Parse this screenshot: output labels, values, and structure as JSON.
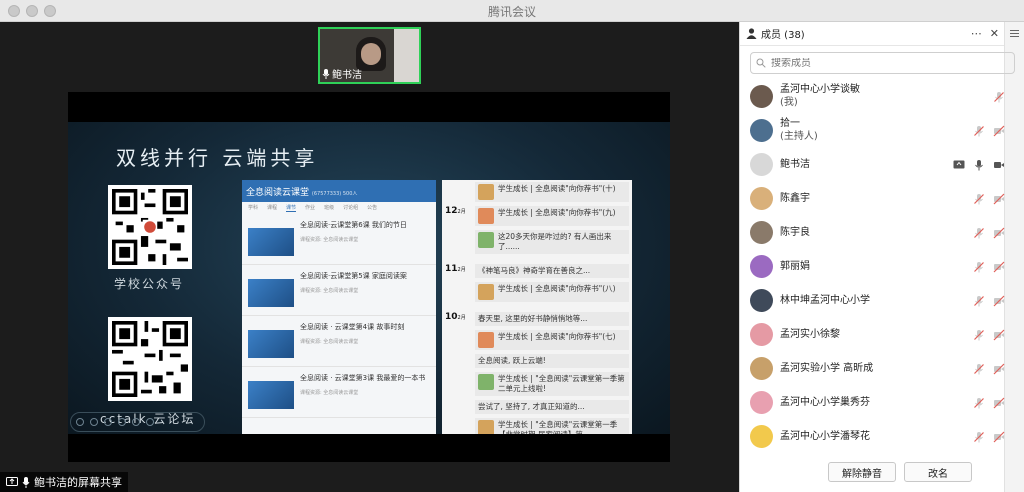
{
  "window": {
    "title": "腾讯会议"
  },
  "video": {
    "self_name": "鲍书洁"
  },
  "share": {
    "label": "鲍书洁的屏幕共享",
    "slide": {
      "title": "双线并行  云端共享",
      "qr1_caption": "学校公众号",
      "qr2_caption": "cctalk  云论坛"
    },
    "shot1": {
      "header": "全息阅读云课堂",
      "header_meta": "(67577333)  500人",
      "tabs": [
        "学科",
        "课程",
        "课节",
        "作业",
        "班级",
        "讨论组",
        "公告"
      ],
      "courses": [
        {
          "title": "全息阅读·云课堂第6课 我们的节日",
          "meta": "课程资源: 全息阅读云课堂"
        },
        {
          "title": "全息阅读·云课堂第5课 家庭阅读案",
          "meta": "课程资源: 全息阅读云课堂"
        },
        {
          "title": "全息阅读 · 云课堂第4课  故事时刻",
          "meta": "课程资源: 全息阅读云课堂"
        },
        {
          "title": "全息阅读 · 云课堂第3课 我最爱的一本书",
          "meta": "课程资源: 全息阅读云课堂"
        }
      ]
    },
    "shot2": {
      "items": [
        {
          "date": "",
          "text": "学生成长 | 全息阅读\"向你荐书\"(十)"
        },
        {
          "date": "12",
          "month": "2月",
          "text": "学生成长 | 全息阅读\"向你荐书\"(九)"
        },
        {
          "date": "",
          "text": "这20多天你是咋过的? 有人画出来了......"
        },
        {
          "date": "11",
          "month": "2月",
          "text": "《神笔马良》神奇学育在善良之..."
        },
        {
          "date": "",
          "text": "学生成长 | 全息阅读\"向你荐书\"(八)"
        },
        {
          "date": "10",
          "month": "2月",
          "text": "春天里, 这里的好书静悄悄地等..."
        },
        {
          "date": "",
          "text": "学生成长 | 全息阅读\"向你荐书\"(七)"
        },
        {
          "date": "",
          "text": "全息阅读, 跃上云端!"
        },
        {
          "date": "",
          "text": "学生成长 | \"全息阅读\"云课堂第一季第二单元上线啦!"
        },
        {
          "date": "",
          "text": "尝试了, 坚持了, 才真正知道的..."
        },
        {
          "date": "",
          "text": "学生成长 | \"全息阅读\"云课堂第一季【非常时期 居家阅读】第..."
        }
      ]
    }
  },
  "members": {
    "header": "成员 (38)",
    "more_icon": "⋯",
    "close_icon": "✕",
    "search_placeholder": "搜索成员",
    "list": [
      {
        "name": "孟河中心小学谈敏",
        "role": "(我)",
        "avatar_color": "#6b5a4e",
        "muted": true
      },
      {
        "name": "拾一",
        "role": "(主持人)",
        "avatar_color": "#4d6f8f",
        "muted": true
      },
      {
        "name": "鲍书洁",
        "role": "",
        "avatar_color": "#d8d8d8",
        "muted": false,
        "sharing": true
      },
      {
        "name": "陈鑫宇",
        "role": "",
        "avatar_color": "#d9b07a",
        "muted": true
      },
      {
        "name": "陈宇良",
        "role": "",
        "avatar_color": "#8a7a6a",
        "muted": true
      },
      {
        "name": "郭丽娟",
        "role": "",
        "avatar_color": "#9b6ac1",
        "muted": true
      },
      {
        "name": "林中坤孟河中心小学",
        "role": "",
        "avatar_color": "#3f4a5a",
        "muted": true
      },
      {
        "name": "孟河实小徐黎",
        "role": "",
        "avatar_color": "#e59aa4",
        "muted": true
      },
      {
        "name": "孟河实验小学 高昕成",
        "role": "",
        "avatar_color": "#c7a06a",
        "muted": true
      },
      {
        "name": "孟河中心小学巢秀芬",
        "role": "",
        "avatar_color": "#e8a0b0",
        "muted": true
      },
      {
        "name": "孟河中心小学潘琴花",
        "role": "",
        "avatar_color": "#f2c94c",
        "muted": true
      }
    ],
    "unmute_all": "解除静音",
    "rename": "改名"
  },
  "colors": {
    "accent_green": "#2fd158",
    "muted_red": "#e0605a",
    "share_blue": "#2f6fb3"
  }
}
